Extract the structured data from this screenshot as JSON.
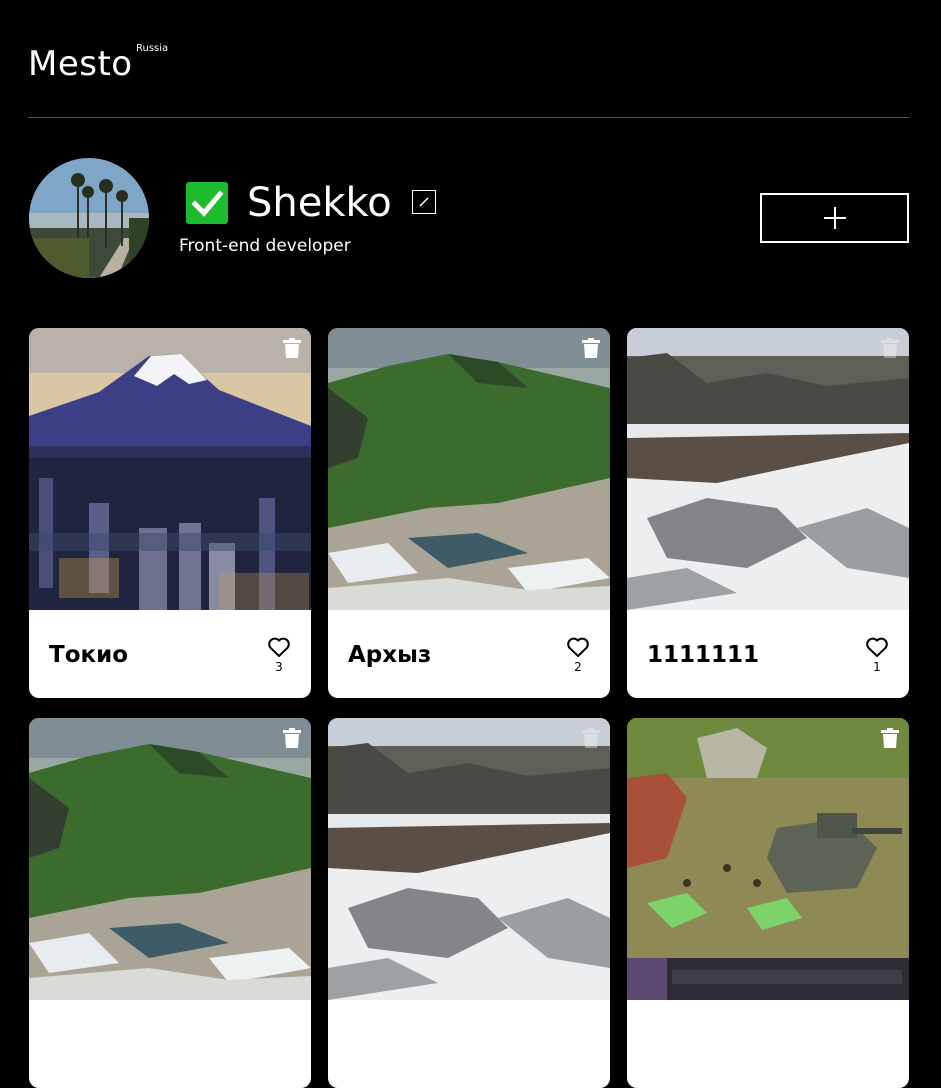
{
  "header": {
    "logo": "Mesto",
    "logo_sup": "Russia"
  },
  "profile": {
    "name": "Shekko",
    "about": "Front-end developer",
    "verified_icon": "check-icon",
    "colors": {
      "verified": "#1fbb2e"
    }
  },
  "cards": [
    {
      "title": "Токио",
      "likes": "3",
      "image": "mount-fuji-tokyo"
    },
    {
      "title": "Архыз",
      "likes": "2",
      "image": "green-mountains"
    },
    {
      "title": "1111111",
      "likes": "1",
      "image": "snowy-river"
    },
    {
      "title": "",
      "likes": "",
      "image": "green-mountains"
    },
    {
      "title": "",
      "likes": "",
      "image": "snowy-river"
    },
    {
      "title": "",
      "likes": "",
      "image": "war-game-scene"
    }
  ]
}
